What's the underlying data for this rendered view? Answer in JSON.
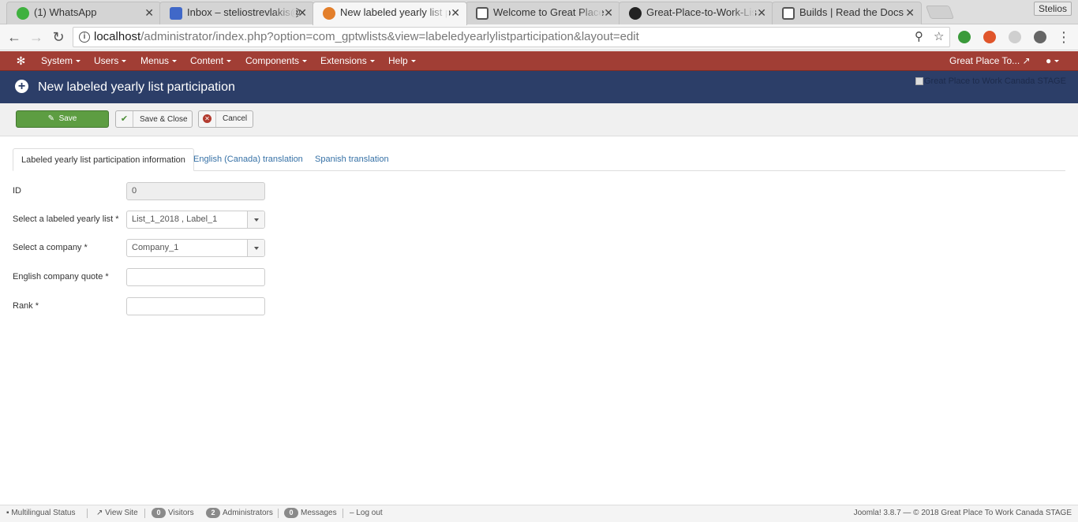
{
  "browser": {
    "tabs": [
      {
        "title": "(1) WhatsApp",
        "favicon": "whatsapp-icon",
        "color": "#3fb13f"
      },
      {
        "title": "Inbox – steliostrevlakis@",
        "favicon": "inbox-icon",
        "color": "#4068c8"
      },
      {
        "title": "New labeled yearly list p",
        "favicon": "joomla-icon",
        "color": "#e37f2b"
      },
      {
        "title": "Welcome to Great Place",
        "favicon": "doc-icon",
        "color": "#555555"
      },
      {
        "title": "Great-Place-to-Work-Lis",
        "favicon": "github-icon",
        "color": "#222222"
      },
      {
        "title": "Builds | Read the Docs",
        "favicon": "doc-icon",
        "color": "#555555"
      }
    ],
    "profile_name": "Stelios",
    "url_host": "localhost",
    "url_path": "/administrator/index.php?option=com_gptwlists&view=labeledyearlylistparticipation&layout=edit"
  },
  "admin_menu": {
    "items": [
      "System",
      "Users",
      "Menus",
      "Content",
      "Components",
      "Extensions",
      "Help"
    ],
    "site_link": "Great Place To..."
  },
  "header": {
    "title": "New labeled yearly list participation",
    "brand_alt": "Great Place to Work Canada STAGE"
  },
  "toolbar": {
    "save_label": "Save",
    "save_close_label": "Save & Close",
    "cancel_label": "Cancel"
  },
  "tabs": [
    "Labeled yearly list participation information",
    "English (Canada) translation",
    "Spanish translation"
  ],
  "form": {
    "id_label": "ID",
    "id_value": "0",
    "list_label": "Select a labeled yearly list *",
    "list_value": "List_1_2018 , Label_1",
    "company_label": "Select a company *",
    "company_value": "Company_1",
    "quote_label": "English company quote *",
    "quote_value": "",
    "rank_label": "Rank *",
    "rank_value": ""
  },
  "status": {
    "multilingual": "Multilingual Status",
    "view_site": "View Site",
    "visitors_count": "0",
    "visitors_label": "Visitors",
    "admins_count": "2",
    "admins_label": "Administrators",
    "messages_count": "0",
    "messages_label": "Messages",
    "logout": "Log out",
    "footer": "Joomla! 3.8.7 — © 2018 Great Place To Work Canada STAGE"
  },
  "colors": {
    "admin_nav": "#a13e35",
    "title_bar": "#2c3e68",
    "save_button": "#5d9d42",
    "link": "#3671a6"
  }
}
